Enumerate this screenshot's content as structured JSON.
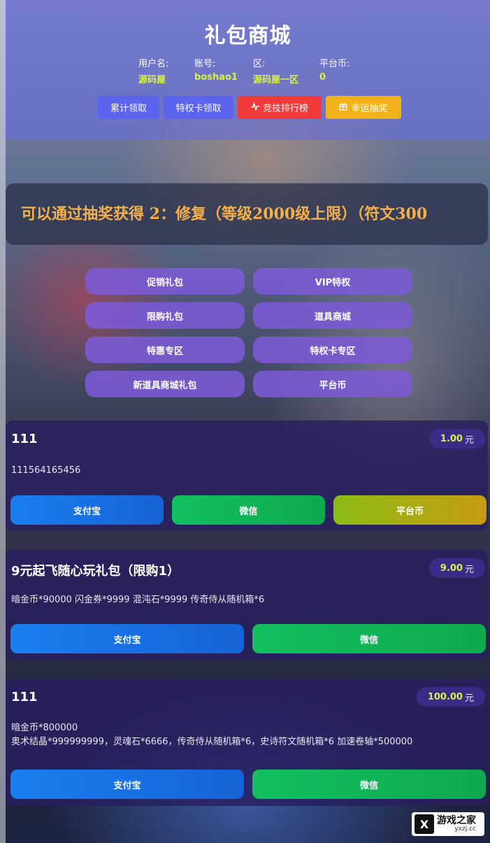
{
  "header": {
    "title": "礼包商城",
    "info": [
      {
        "label": "用户名:",
        "value": "源码屋"
      },
      {
        "label": "账号:",
        "value": "boshao1"
      },
      {
        "label": "区:",
        "value": "源码屋一区"
      },
      {
        "label": "平台币:",
        "value": "0"
      }
    ],
    "buttons": [
      {
        "label": "累计领取",
        "icon": ""
      },
      {
        "label": "特权卡领取",
        "icon": ""
      },
      {
        "label": "竞技排行榜",
        "icon": "pulse-icon"
      },
      {
        "label": "幸运抽奖",
        "icon": "gift-icon"
      }
    ]
  },
  "marquee": {
    "text": "可以通过抽奖获得 2：修复（等级2000级上限）（符文300"
  },
  "categories": [
    "促销礼包",
    "VIP特权",
    "限购礼包",
    "道具商城",
    "特惠专区",
    "特权卡专区",
    "新道具商城礼包",
    "平台币"
  ],
  "products": [
    {
      "name": "111",
      "price": "1.00",
      "unit": "元",
      "desc_lines": [
        "111564165456"
      ],
      "pay": [
        "支付宝",
        "微信",
        "平台币"
      ]
    },
    {
      "name": "9元起飞随心玩礼包（限购1）",
      "price": "9.00",
      "unit": "元",
      "desc_lines": [
        "暗金币*90000 闪金券*9999 混沌石*9999 传奇侍从随机箱*6"
      ],
      "pay": [
        "支付宝",
        "微信"
      ]
    },
    {
      "name": "111",
      "price": "100.00",
      "unit": "元",
      "desc_lines": [
        "暗金币*800000",
        "奥术结晶*999999999，灵魂石*6666，传奇侍从随机箱*6，史诗符文随机箱*6 加速卷轴*500000"
      ],
      "pay": [
        "支付宝",
        "微信"
      ]
    }
  ],
  "watermark": {
    "mark": "X",
    "name": "游戏之家",
    "url": "yxzj.cc"
  },
  "colors": {
    "accent_yellow": "#d8f04a",
    "header_bg": "#6a6edc",
    "card_bg": "#281e5f",
    "marquee_text": "#f6b04a"
  }
}
